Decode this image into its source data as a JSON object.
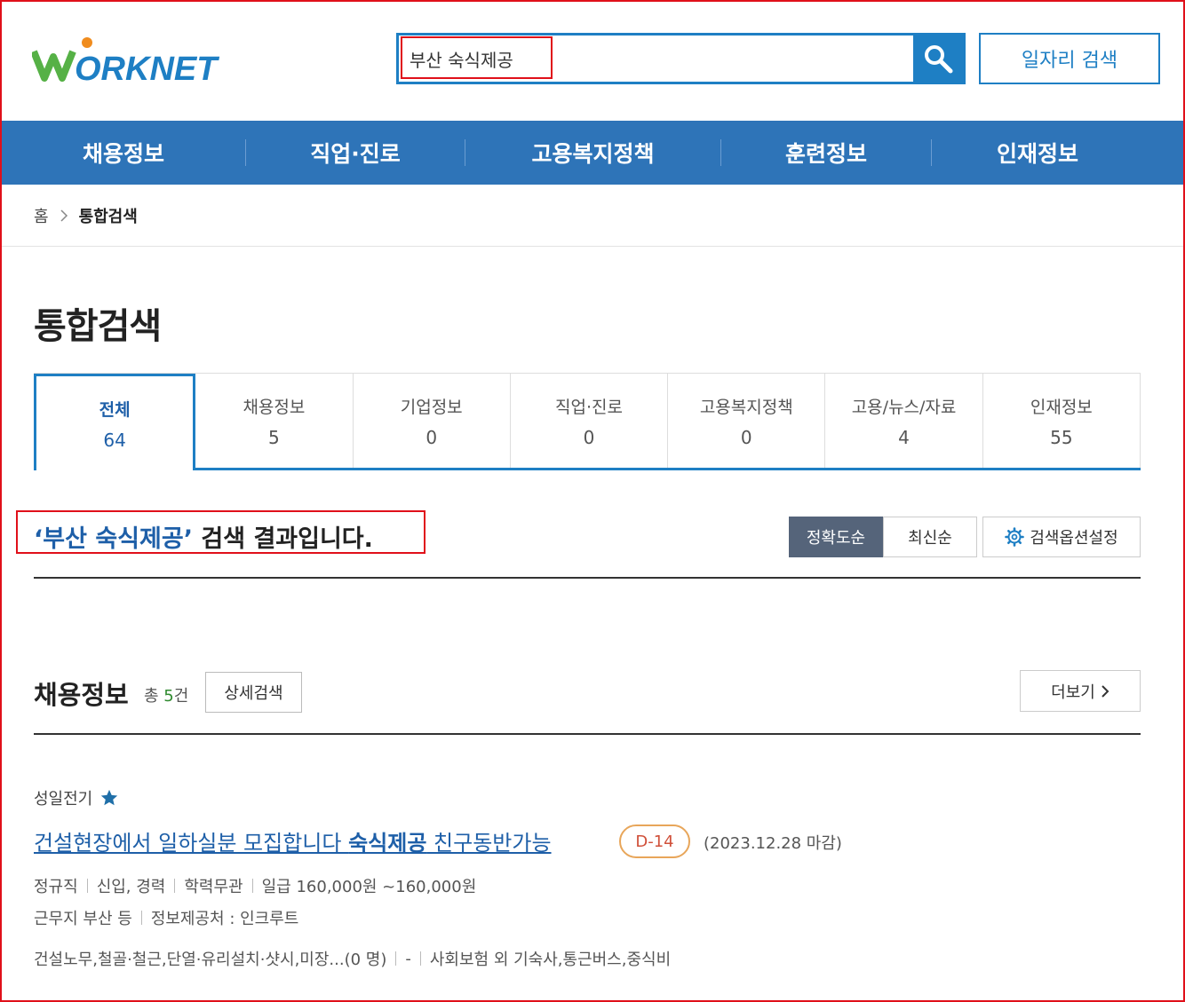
{
  "header": {
    "logo_text": "WORKNET",
    "search_value": "부산 숙식제공",
    "job_search_label": "일자리 검색"
  },
  "gnb": [
    "채용정보",
    "직업·진로",
    "고용복지정책",
    "훈련정보",
    "인재정보"
  ],
  "breadcrumb": {
    "home": "홈",
    "current": "통합검색"
  },
  "page_title": "통합검색",
  "tabs": [
    {
      "label": "전체",
      "count": "64"
    },
    {
      "label": "채용정보",
      "count": "5"
    },
    {
      "label": "기업정보",
      "count": "0"
    },
    {
      "label": "직업·진로",
      "count": "0"
    },
    {
      "label": "고용복지정책",
      "count": "0"
    },
    {
      "label": "고용/뉴스/자료",
      "count": "4"
    },
    {
      "label": "인재정보",
      "count": "55"
    }
  ],
  "result": {
    "keyword_quoted": "‘부산 숙식제공’",
    "suffix": " 검색 결과입니다."
  },
  "sort": {
    "accuracy": "정확도순",
    "latest": "최신순",
    "options": "검색옵션설정"
  },
  "section": {
    "title": "채용정보",
    "count_prefix": "총 ",
    "count_value": "5",
    "count_suffix": "건",
    "detail_label": "상세검색",
    "more_label": "더보기"
  },
  "job": {
    "company": "성일전기",
    "title_part1": "건설현장에서 일하실분 모집합니다 ",
    "title_keyword": "숙식제공",
    "title_part2": " 친구동반가능",
    "dday": "D-14",
    "deadline": "(2023.12.28 마감)",
    "meta1": [
      "정규직",
      "신입, 경력",
      "학력무관",
      "일급 160,000원 ~160,000원"
    ],
    "meta2": [
      "근무지 부산 등",
      "정보제공처 : 인크루트"
    ],
    "meta3": [
      "건설노무,철골·철근,단열·유리설치·샷시,미장...(0 명)",
      "-",
      "사회보험 외 기숙사,통근버스,중식비"
    ]
  },
  "colors": {
    "primary": "#1e7fc4",
    "nav": "#2e74b8",
    "highlight": "#e0101a"
  }
}
